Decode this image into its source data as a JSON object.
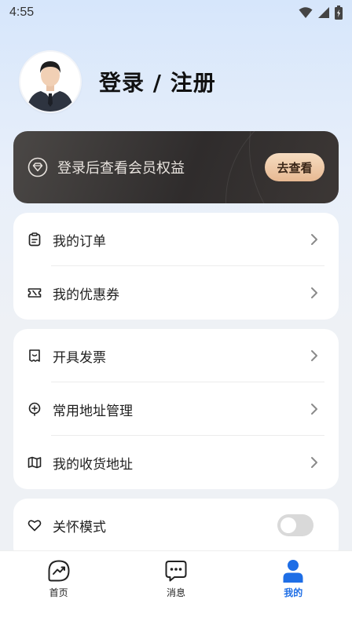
{
  "status_bar": {
    "time": "4:55"
  },
  "profile": {
    "title": "登录 / 注册"
  },
  "vip": {
    "text": "登录后查看会员权益",
    "button": "去查看"
  },
  "menu_group_1": [
    {
      "label": "我的订单",
      "icon": "clipboard-icon"
    },
    {
      "label": "我的优惠券",
      "icon": "coupon-icon"
    }
  ],
  "menu_group_2": [
    {
      "label": "开具发票",
      "icon": "receipt-icon"
    },
    {
      "label": "常用地址管理",
      "icon": "location-pin-icon"
    },
    {
      "label": "我的收货地址",
      "icon": "map-icon"
    }
  ],
  "menu_group_3": [
    {
      "label": "关怀模式",
      "icon": "heart-icon",
      "toggle_on": false
    }
  ],
  "tabbar": [
    {
      "label": "首页",
      "icon": "home-chart-icon",
      "active": false
    },
    {
      "label": "消息",
      "icon": "message-icon",
      "active": false
    },
    {
      "label": "我的",
      "icon": "person-icon",
      "active": true
    }
  ],
  "colors": {
    "accent": "#1e6ee6",
    "vip_button": "#e7b992",
    "vip_card": "#2f2c2c"
  }
}
